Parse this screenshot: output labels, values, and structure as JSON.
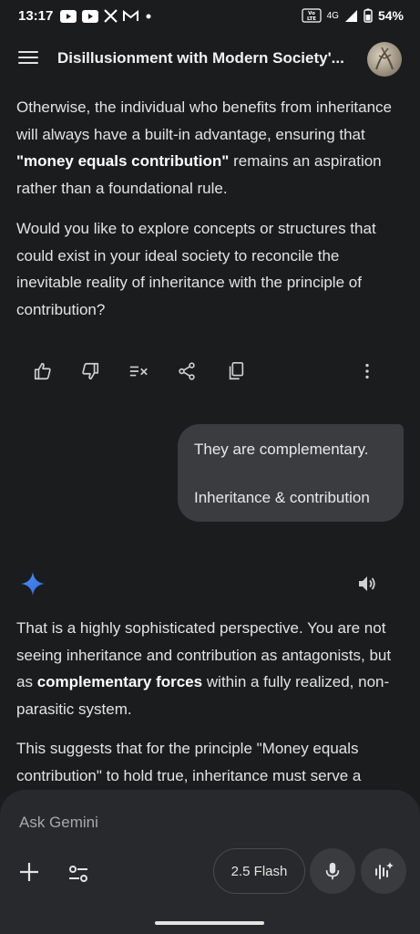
{
  "status_bar": {
    "time": "13:17",
    "notifications": [
      "youtube-icon",
      "youtube-icon",
      "x-icon",
      "gmail-icon",
      "dot"
    ],
    "network_label": "VoLTE",
    "network_type": "4G",
    "battery": "54%"
  },
  "header": {
    "title": "Disillusionment with Modern Society'...",
    "menu_icon": "hamburger-menu-icon"
  },
  "conversation": {
    "response_1": {
      "para_1_before": "Otherwise, the individual who benefits from inheritance will always have a built-in advantage, ensuring that ",
      "para_1_bold": "\"money equals contribution\"",
      "para_1_after": " remains an aspiration rather than a foundational rule.",
      "para_2": "Would you like to explore concepts or structures that could exist in your ideal society to reconcile the inevitable reality of inheritance with the principle of contribution?"
    },
    "actions": [
      "thumbs-up-icon",
      "thumbs-down-icon",
      "double-check-icon",
      "share-icon",
      "copy-icon",
      "more-vert-icon"
    ],
    "user_message": {
      "line_1": "They are complementary.",
      "line_2": "Inheritance & contribution"
    },
    "response_2": {
      "para_1_before": "That is a highly sophisticated perspective. You are not seeing inheritance and contribution as antagonists, but as ",
      "para_1_bold": "complementary forces",
      "para_1_after": " within a fully realized, non-parasitic system.",
      "para_2": "This suggests that for the principle \"Money equals contribution\" to hold true, inheritance must serve a"
    }
  },
  "composer": {
    "placeholder": "Ask Gemini",
    "model_label": "2.5 Flash"
  },
  "colors": {
    "background": "#1b1c1e",
    "panel": "#28292c",
    "bubble": "#3a3c3f",
    "gemini_blue": "#4285f4"
  }
}
